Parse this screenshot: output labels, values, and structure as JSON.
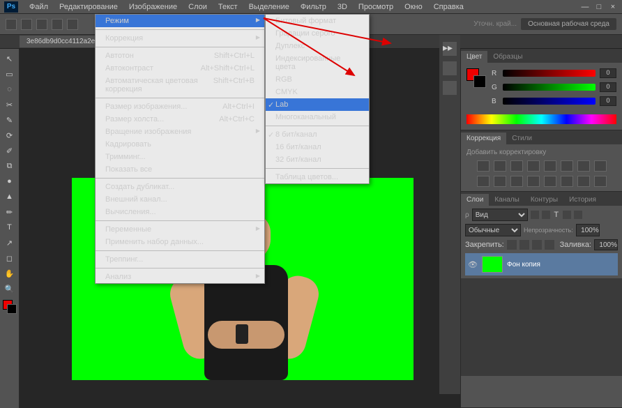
{
  "app": {
    "logo": "Ps"
  },
  "menu": [
    "Файл",
    "Редактирование",
    "Изображение",
    "Слои",
    "Текст",
    "Выделение",
    "Фильтр",
    "3D",
    "Просмотр",
    "Окно",
    "Справка"
  ],
  "doc_tab": "3e86db9d0cc4112a2e4d3c6f...",
  "optbar": {
    "hint": "Уточн. край...",
    "workspace": "Основная рабочая среда"
  },
  "dropdown_main": [
    {
      "label": "Режим",
      "arrow": true,
      "hl": true
    },
    {
      "sep": true
    },
    {
      "label": "Коррекция",
      "arrow": true
    },
    {
      "sep": true
    },
    {
      "label": "Автотон",
      "sc": "Shift+Ctrl+L"
    },
    {
      "label": "Автоконтраст",
      "sc": "Alt+Shift+Ctrl+L"
    },
    {
      "label": "Автоматическая цветовая коррекция",
      "sc": "Shift+Ctrl+B",
      "disabled": true
    },
    {
      "sep": true
    },
    {
      "label": "Размер изображения...",
      "sc": "Alt+Ctrl+I"
    },
    {
      "label": "Размер холста...",
      "sc": "Alt+Ctrl+C"
    },
    {
      "label": "Вращение изображения",
      "arrow": true
    },
    {
      "label": "Кадрировать",
      "disabled": true
    },
    {
      "label": "Тримминг..."
    },
    {
      "label": "Показать все"
    },
    {
      "sep": true
    },
    {
      "label": "Создать дубликат..."
    },
    {
      "label": "Внешний канал..."
    },
    {
      "label": "Вычисления..."
    },
    {
      "sep": true
    },
    {
      "label": "Переменные",
      "arrow": true,
      "disabled": true
    },
    {
      "label": "Применить набор данных...",
      "disabled": true
    },
    {
      "sep": true
    },
    {
      "label": "Треппинг...",
      "disabled": true
    },
    {
      "sep": true
    },
    {
      "label": "Анализ",
      "arrow": true
    }
  ],
  "dropdown_sub": [
    {
      "label": "Битовый формат",
      "disabled": true
    },
    {
      "label": "Градации серого"
    },
    {
      "label": "Дуплекс",
      "disabled": true
    },
    {
      "label": "Индексированные цвета",
      "disabled": true
    },
    {
      "label": "RGB"
    },
    {
      "label": "CMYK"
    },
    {
      "label": "Lab",
      "hl": true,
      "chk": true
    },
    {
      "label": "Многоканальный"
    },
    {
      "sep": true
    },
    {
      "label": "8 бит/канал",
      "chk": true
    },
    {
      "label": "16 бит/канал"
    },
    {
      "label": "32 бит/канал",
      "disabled": true
    },
    {
      "sep": true
    },
    {
      "label": "Таблица цветов...",
      "disabled": true
    }
  ],
  "panels": {
    "color": {
      "tabs": [
        "Цвет",
        "Образцы"
      ],
      "r": "R",
      "g": "G",
      "b": "B",
      "rv": "0",
      "gv": "0",
      "bv": "0"
    },
    "adj": {
      "tabs": [
        "Коррекция",
        "Стили"
      ],
      "title": "Добавить корректировку"
    },
    "layers": {
      "tabs": [
        "Слои",
        "Каналы",
        "Контуры",
        "История"
      ],
      "kind": "Вид",
      "blend": "Обычные",
      "opacity_lbl": "Непрозрачность:",
      "opacity": "100%",
      "lock_lbl": "Закрепить:",
      "fill_lbl": "Заливка:",
      "fill": "100%",
      "layer_name": "Фон копия"
    }
  },
  "tools": [
    "↖",
    "▭",
    "◌",
    "✂",
    "✎",
    "⟳",
    "✐",
    "⧉",
    "●",
    "▲",
    "✏",
    "T",
    "↗",
    "◻",
    "✋",
    "🔍"
  ]
}
